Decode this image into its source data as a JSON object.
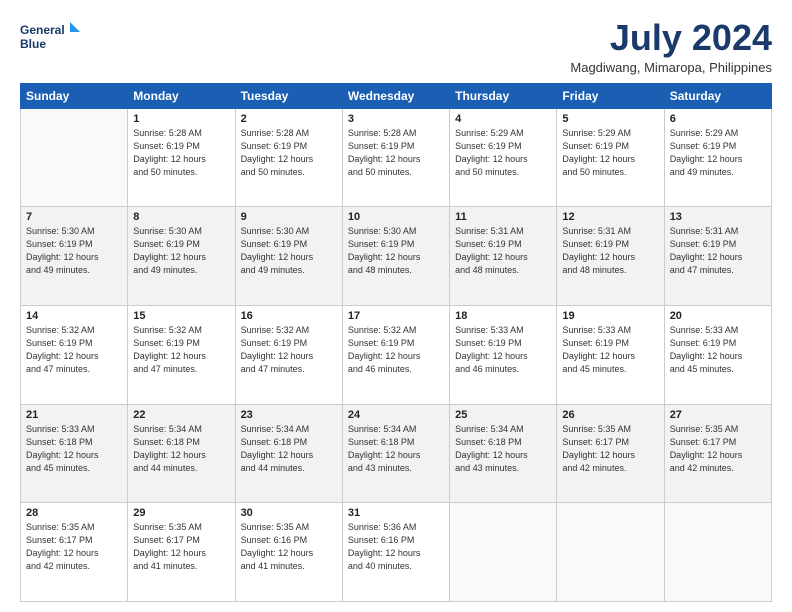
{
  "header": {
    "logo_line1": "General",
    "logo_line2": "Blue",
    "title": "July 2024",
    "location": "Magdiwang, Mimaropa, Philippines"
  },
  "weekdays": [
    "Sunday",
    "Monday",
    "Tuesday",
    "Wednesday",
    "Thursday",
    "Friday",
    "Saturday"
  ],
  "weeks": [
    [
      {
        "day": "",
        "info": ""
      },
      {
        "day": "1",
        "info": "Sunrise: 5:28 AM\nSunset: 6:19 PM\nDaylight: 12 hours\nand 50 minutes."
      },
      {
        "day": "2",
        "info": "Sunrise: 5:28 AM\nSunset: 6:19 PM\nDaylight: 12 hours\nand 50 minutes."
      },
      {
        "day": "3",
        "info": "Sunrise: 5:28 AM\nSunset: 6:19 PM\nDaylight: 12 hours\nand 50 minutes."
      },
      {
        "day": "4",
        "info": "Sunrise: 5:29 AM\nSunset: 6:19 PM\nDaylight: 12 hours\nand 50 minutes."
      },
      {
        "day": "5",
        "info": "Sunrise: 5:29 AM\nSunset: 6:19 PM\nDaylight: 12 hours\nand 50 minutes."
      },
      {
        "day": "6",
        "info": "Sunrise: 5:29 AM\nSunset: 6:19 PM\nDaylight: 12 hours\nand 49 minutes."
      }
    ],
    [
      {
        "day": "7",
        "info": "Sunrise: 5:30 AM\nSunset: 6:19 PM\nDaylight: 12 hours\nand 49 minutes."
      },
      {
        "day": "8",
        "info": "Sunrise: 5:30 AM\nSunset: 6:19 PM\nDaylight: 12 hours\nand 49 minutes."
      },
      {
        "day": "9",
        "info": "Sunrise: 5:30 AM\nSunset: 6:19 PM\nDaylight: 12 hours\nand 49 minutes."
      },
      {
        "day": "10",
        "info": "Sunrise: 5:30 AM\nSunset: 6:19 PM\nDaylight: 12 hours\nand 48 minutes."
      },
      {
        "day": "11",
        "info": "Sunrise: 5:31 AM\nSunset: 6:19 PM\nDaylight: 12 hours\nand 48 minutes."
      },
      {
        "day": "12",
        "info": "Sunrise: 5:31 AM\nSunset: 6:19 PM\nDaylight: 12 hours\nand 48 minutes."
      },
      {
        "day": "13",
        "info": "Sunrise: 5:31 AM\nSunset: 6:19 PM\nDaylight: 12 hours\nand 47 minutes."
      }
    ],
    [
      {
        "day": "14",
        "info": "Sunrise: 5:32 AM\nSunset: 6:19 PM\nDaylight: 12 hours\nand 47 minutes."
      },
      {
        "day": "15",
        "info": "Sunrise: 5:32 AM\nSunset: 6:19 PM\nDaylight: 12 hours\nand 47 minutes."
      },
      {
        "day": "16",
        "info": "Sunrise: 5:32 AM\nSunset: 6:19 PM\nDaylight: 12 hours\nand 47 minutes."
      },
      {
        "day": "17",
        "info": "Sunrise: 5:32 AM\nSunset: 6:19 PM\nDaylight: 12 hours\nand 46 minutes."
      },
      {
        "day": "18",
        "info": "Sunrise: 5:33 AM\nSunset: 6:19 PM\nDaylight: 12 hours\nand 46 minutes."
      },
      {
        "day": "19",
        "info": "Sunrise: 5:33 AM\nSunset: 6:19 PM\nDaylight: 12 hours\nand 45 minutes."
      },
      {
        "day": "20",
        "info": "Sunrise: 5:33 AM\nSunset: 6:19 PM\nDaylight: 12 hours\nand 45 minutes."
      }
    ],
    [
      {
        "day": "21",
        "info": "Sunrise: 5:33 AM\nSunset: 6:18 PM\nDaylight: 12 hours\nand 45 minutes."
      },
      {
        "day": "22",
        "info": "Sunrise: 5:34 AM\nSunset: 6:18 PM\nDaylight: 12 hours\nand 44 minutes."
      },
      {
        "day": "23",
        "info": "Sunrise: 5:34 AM\nSunset: 6:18 PM\nDaylight: 12 hours\nand 44 minutes."
      },
      {
        "day": "24",
        "info": "Sunrise: 5:34 AM\nSunset: 6:18 PM\nDaylight: 12 hours\nand 43 minutes."
      },
      {
        "day": "25",
        "info": "Sunrise: 5:34 AM\nSunset: 6:18 PM\nDaylight: 12 hours\nand 43 minutes."
      },
      {
        "day": "26",
        "info": "Sunrise: 5:35 AM\nSunset: 6:17 PM\nDaylight: 12 hours\nand 42 minutes."
      },
      {
        "day": "27",
        "info": "Sunrise: 5:35 AM\nSunset: 6:17 PM\nDaylight: 12 hours\nand 42 minutes."
      }
    ],
    [
      {
        "day": "28",
        "info": "Sunrise: 5:35 AM\nSunset: 6:17 PM\nDaylight: 12 hours\nand 42 minutes."
      },
      {
        "day": "29",
        "info": "Sunrise: 5:35 AM\nSunset: 6:17 PM\nDaylight: 12 hours\nand 41 minutes."
      },
      {
        "day": "30",
        "info": "Sunrise: 5:35 AM\nSunset: 6:16 PM\nDaylight: 12 hours\nand 41 minutes."
      },
      {
        "day": "31",
        "info": "Sunrise: 5:36 AM\nSunset: 6:16 PM\nDaylight: 12 hours\nand 40 minutes."
      },
      {
        "day": "",
        "info": ""
      },
      {
        "day": "",
        "info": ""
      },
      {
        "day": "",
        "info": ""
      }
    ]
  ]
}
